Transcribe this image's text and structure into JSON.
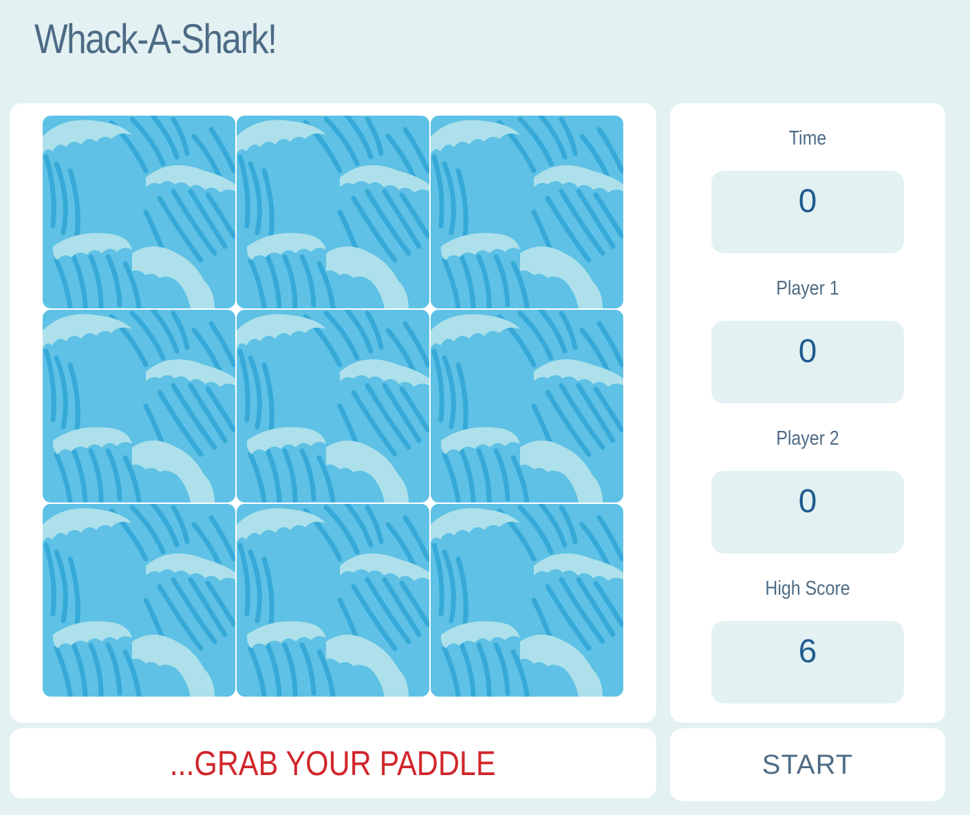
{
  "game": {
    "title": "Whack-A-Shark!"
  },
  "board": {
    "holes": [
      {
        "tile": "wave-icon"
      },
      {
        "tile": "wave-icon"
      },
      {
        "tile": "wave-icon"
      },
      {
        "tile": "wave-icon"
      },
      {
        "tile": "wave-icon"
      },
      {
        "tile": "wave-icon"
      },
      {
        "tile": "wave-icon"
      },
      {
        "tile": "wave-icon"
      },
      {
        "tile": "wave-icon"
      }
    ]
  },
  "stats": {
    "time": {
      "label": "Time",
      "value": "0"
    },
    "player1": {
      "label": "Player 1",
      "value": "0"
    },
    "player2": {
      "label": "Player 2",
      "value": "0"
    },
    "high_score": {
      "label": "High Score",
      "value": "6"
    }
  },
  "message": "...GRAB YOUR PADDLE",
  "controls": {
    "start_label": "START"
  },
  "colors": {
    "background": "#e3f1f3",
    "panel": "#ffffff",
    "water": "#5ec1e5",
    "wave_dark": "#36a9d8",
    "wave_foam": "#ade0ea",
    "title": "#4d6b85",
    "score_value": "#1f5b8f",
    "message": "#d1252a"
  }
}
